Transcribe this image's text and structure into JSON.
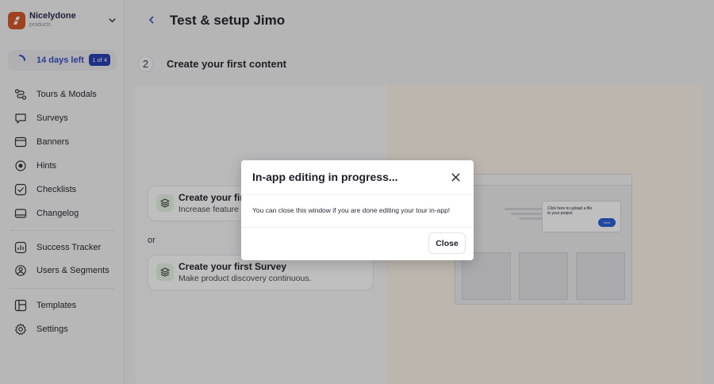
{
  "brand": {
    "name": "Nicelydone",
    "subtitle": "products"
  },
  "trial": {
    "label": "14 days left",
    "badge": "1 of 4"
  },
  "sidebar": {
    "items": [
      {
        "label": "Tours & Modals",
        "icon": "tours-icon"
      },
      {
        "label": "Surveys",
        "icon": "survey-icon"
      },
      {
        "label": "Banners",
        "icon": "banner-icon"
      },
      {
        "label": "Hints",
        "icon": "hint-icon"
      },
      {
        "label": "Checklists",
        "icon": "checklist-icon"
      },
      {
        "label": "Changelog",
        "icon": "changelog-icon"
      },
      {
        "label": "Success Tracker",
        "icon": "tracker-icon"
      },
      {
        "label": "Users & Segments",
        "icon": "users-icon"
      },
      {
        "label": "Templates",
        "icon": "templates-icon"
      },
      {
        "label": "Settings",
        "icon": "gear-icon"
      }
    ]
  },
  "header": {
    "title": "Test & setup Jimo"
  },
  "step": {
    "number": "2",
    "title": "Create your first content"
  },
  "options": [
    {
      "title": "Create your first",
      "description": "Increase feature"
    },
    {
      "title": "Create your first Survey",
      "description": "Make product discovery continuous."
    }
  ],
  "or_label": "or",
  "preview": {
    "tooltip_text": "Click here to upload a file to your project",
    "next_label": "Next"
  },
  "modal": {
    "title": "In-app editing in progress...",
    "body": "You can close this window if you are done editing your tour in-app!",
    "close_label": "Close"
  },
  "colors": {
    "accent": "#2b3fb3",
    "brand": "#d4582a",
    "preview_bg": "#fdf3ea"
  }
}
